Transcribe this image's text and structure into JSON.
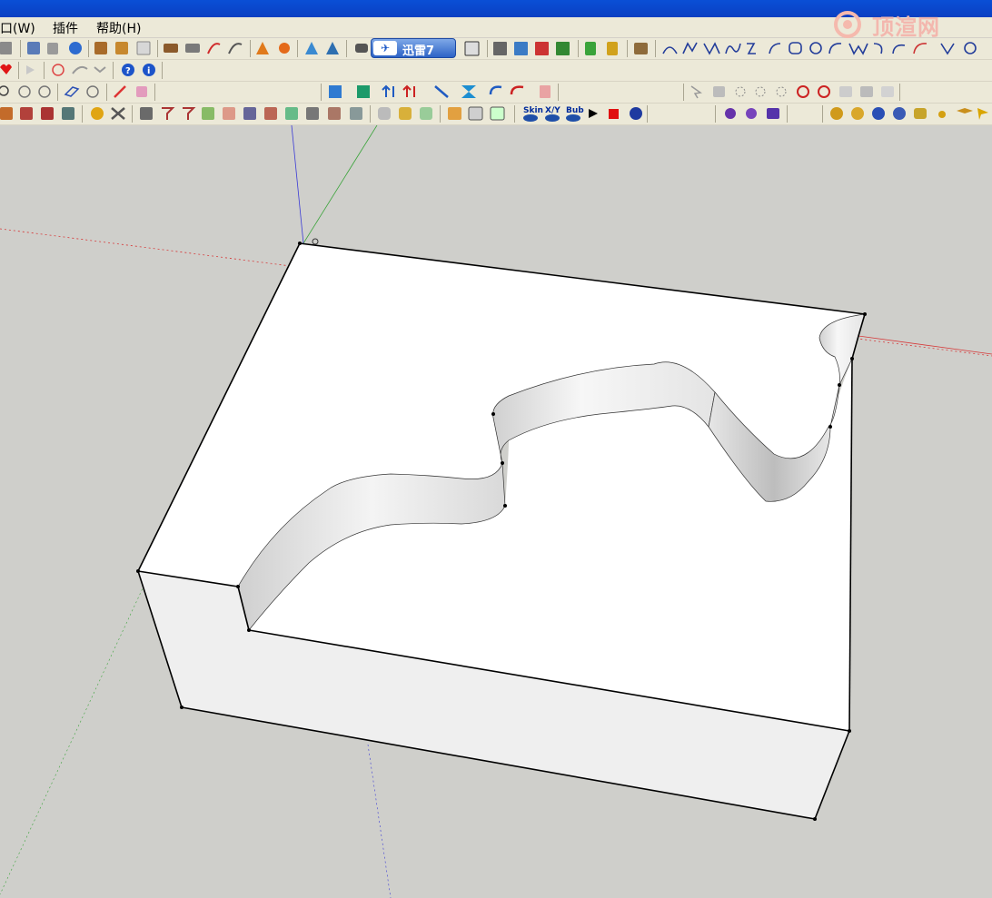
{
  "window": {
    "title": ""
  },
  "watermark": {
    "text": "顶渲网"
  },
  "menu": {
    "items": [
      {
        "label": "窗口(W)",
        "shown": "口(W)"
      },
      {
        "label": "插件"
      },
      {
        "label": "帮助(H)"
      }
    ]
  },
  "toolbar": {
    "xunlei_label": "迅雷7",
    "skin_label": "Skin",
    "xy_label": "X/Y",
    "bub_label": "Bub"
  },
  "scene": {
    "model": "block-with-curved-step",
    "axes_colors": {
      "x": "#d63a3a",
      "y": "#3aa33a",
      "z": "#3a3ad6"
    },
    "background": "#cfcfcb"
  }
}
